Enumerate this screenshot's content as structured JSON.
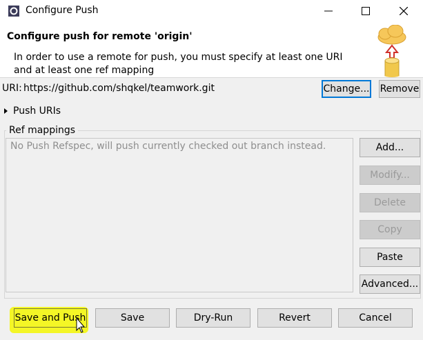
{
  "window": {
    "title": "Configure Push",
    "minimize": "—",
    "maximize": "☐",
    "close": "✕"
  },
  "header": {
    "title": "Configure push for remote 'origin'",
    "message": "In order to use a remote for push, you must specify at least one URI and at least one ref mapping"
  },
  "uri": {
    "label": "URI:",
    "value": "https://github.com/shqkel/teamwork.git",
    "change_label": "Change...",
    "remove_label": "Remove"
  },
  "push_uris": {
    "label": "Push URIs"
  },
  "ref_mappings": {
    "label": "Ref mappings",
    "placeholder": "No Push Refspec, will push currently checked out branch instead.",
    "buttons": {
      "add": "Add...",
      "modify": "Modify...",
      "delete": "Delete",
      "copy": "Copy",
      "paste": "Paste",
      "advanced": "Advanced..."
    }
  },
  "footer": {
    "save_and_push": "Save and Push",
    "save": "Save",
    "dry_run": "Dry-Run",
    "revert": "Revert",
    "cancel": "Cancel"
  },
  "colors": {
    "highlight": "#f3f51a",
    "focus_border": "#0078d7"
  }
}
